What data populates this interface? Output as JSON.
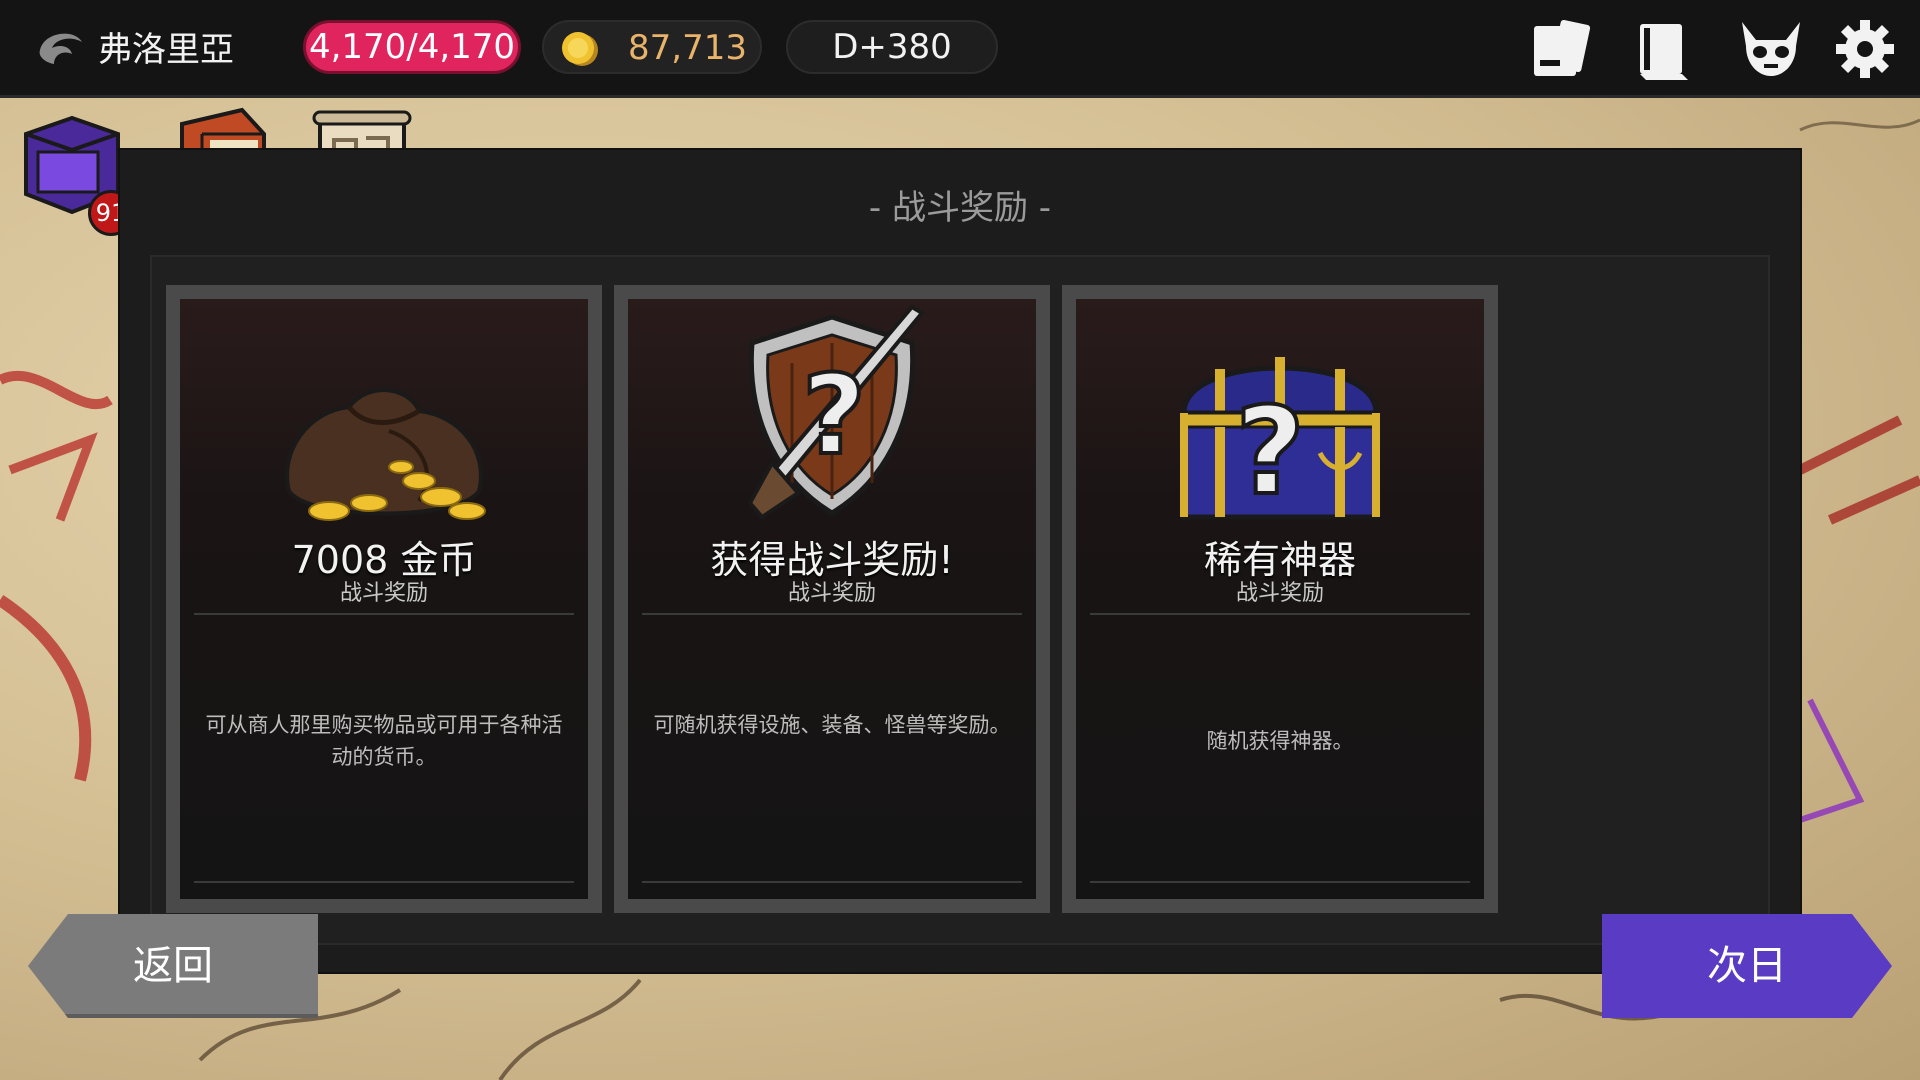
{
  "header": {
    "player_name": "弗洛里亞",
    "hp": "4,170/4,170",
    "gold": "87,713",
    "day": "D+380",
    "icons": [
      "logo-icon",
      "card-icon",
      "book-icon",
      "demon-skull-icon",
      "gear-icon"
    ]
  },
  "quick_items": {
    "chest_badge": "91",
    "icons": [
      "purple-chest-icon",
      "red-book-icon",
      "scroll-map-icon"
    ]
  },
  "dialog": {
    "title": "- 战斗奖励 -",
    "cards": [
      {
        "title": "7008 金币",
        "subtitle": "战斗奖励",
        "description": "可从商人那里购买物品或可用于各种活动的货币。",
        "icon": "gold-sack-icon"
      },
      {
        "title": "获得战斗奖励!",
        "subtitle": "战斗奖励",
        "description": "可随机获得设施、装备、怪兽等奖励。",
        "icon": "mystery-shield-icon"
      },
      {
        "title": "稀有神器",
        "subtitle": "战斗奖励",
        "description": "随机获得神器。",
        "icon": "mystery-chest-icon"
      }
    ]
  },
  "buttons": {
    "back": "返回",
    "next": "次日"
  },
  "colors": {
    "hp": "#e0245e",
    "gold_text": "#e8b36a",
    "next_button": "#5a3bc4",
    "back_button": "#7b7b7b"
  }
}
